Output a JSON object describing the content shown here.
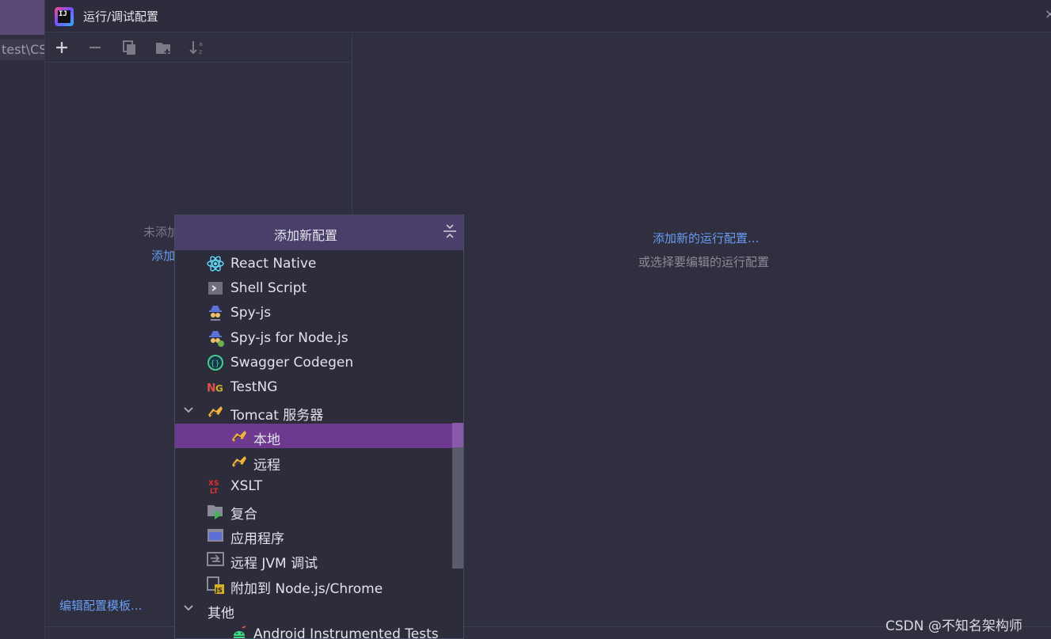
{
  "background": {
    "path_fragment": "test\\CS"
  },
  "dialog": {
    "title": "运行/调试配置",
    "left_pane": {
      "empty_hint": "未添加",
      "empty_link": "添加",
      "edit_templates_link": "编辑配置模板..."
    },
    "right_pane": {
      "add_link": "添加新的运行配置...",
      "hint": "或选择要编辑的运行配置"
    },
    "toolbar": [
      "add-icon",
      "remove-icon",
      "copy-icon",
      "folder-add-icon",
      "sort-icon"
    ]
  },
  "popup": {
    "title": "添加新配置",
    "items": [
      {
        "label": "React Native",
        "icon": "react-icon",
        "indent": 0,
        "expander": false
      },
      {
        "label": "Shell Script",
        "icon": "shell-script-icon",
        "indent": 0,
        "expander": false
      },
      {
        "label": "Spy-js",
        "icon": "spy-js-icon",
        "indent": 0,
        "expander": false
      },
      {
        "label": "Spy-js for Node.js",
        "icon": "spy-js-node-icon",
        "indent": 0,
        "expander": false
      },
      {
        "label": "Swagger Codegen",
        "icon": "swagger-icon",
        "indent": 0,
        "expander": false
      },
      {
        "label": "TestNG",
        "icon": "testng-icon",
        "indent": 0,
        "expander": false
      },
      {
        "label": "Tomcat 服务器",
        "icon": "tomcat-icon",
        "indent": 0,
        "expander": true
      },
      {
        "label": "本地",
        "icon": "tomcat-icon",
        "indent": 1,
        "expander": false,
        "selected": true
      },
      {
        "label": "远程",
        "icon": "tomcat-icon",
        "indent": 1,
        "expander": false
      },
      {
        "label": "XSLT",
        "icon": "xslt-icon",
        "indent": 0,
        "expander": false
      },
      {
        "label": "复合",
        "icon": "compound-icon",
        "indent": 0,
        "expander": false
      },
      {
        "label": "应用程序",
        "icon": "application-icon",
        "indent": 0,
        "expander": false
      },
      {
        "label": "远程 JVM 调试",
        "icon": "remote-jvm-icon",
        "indent": 0,
        "expander": false
      },
      {
        "label": "附加到 Node.js/Chrome",
        "icon": "attach-node-icon",
        "indent": 0,
        "expander": false
      },
      {
        "label": "其他",
        "icon": "",
        "indent": -1,
        "expander": true
      },
      {
        "label": "Android Instrumented Tests",
        "icon": "android-icon",
        "indent": 1,
        "expander": false
      }
    ]
  },
  "watermark": "CSDN @不知名架构师",
  "colors": {
    "selection": "#6e3a90",
    "link": "#6a9cf0",
    "popup_header": "#4a3f6a"
  }
}
